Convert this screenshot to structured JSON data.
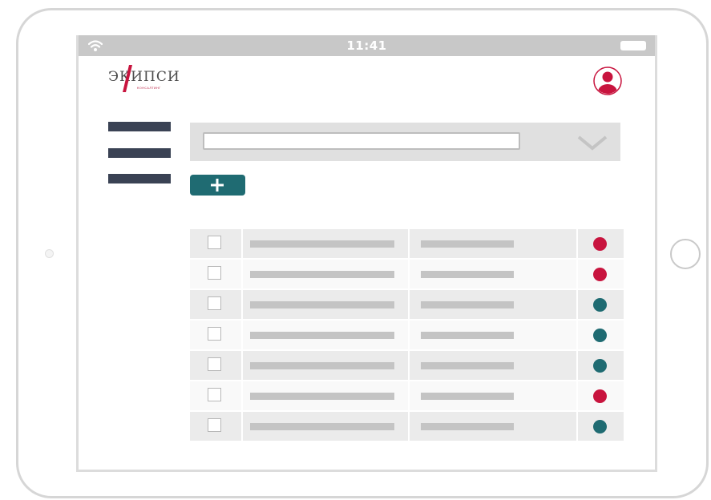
{
  "status_bar": {
    "time": "11:41",
    "icons": [
      "wifi-icon",
      "battery-icon"
    ]
  },
  "header": {
    "logo_text": "ЭКИПСИ",
    "logo_subtext": "КОНСАЛТИНГ",
    "avatar_icon": "user-avatar-icon"
  },
  "toolbar": {
    "menu_icon": "hamburger-menu-icon",
    "select_value": "",
    "dropdown_icon": "chevron-down-icon",
    "add_button_icon": "plus-icon"
  },
  "colors": {
    "accent": "#1f6b72",
    "status_red": "#c8143e",
    "status_teal": "#1f6b72",
    "menu_bars": "#3a4254"
  },
  "table": {
    "rows": [
      {
        "checked": false,
        "status": "red"
      },
      {
        "checked": false,
        "status": "red"
      },
      {
        "checked": false,
        "status": "teal"
      },
      {
        "checked": false,
        "status": "teal"
      },
      {
        "checked": false,
        "status": "teal"
      },
      {
        "checked": false,
        "status": "red"
      },
      {
        "checked": false,
        "status": "teal"
      }
    ]
  }
}
